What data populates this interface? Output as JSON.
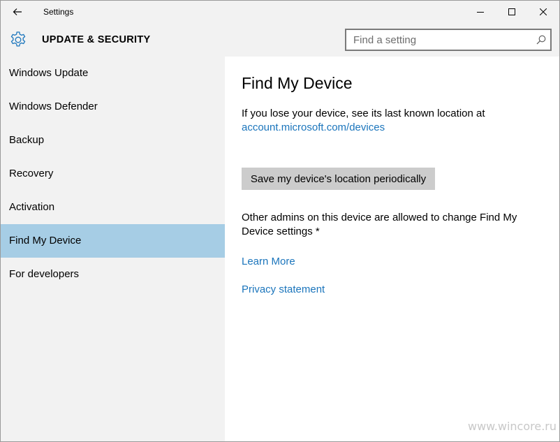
{
  "titlebar": {
    "title": "Settings"
  },
  "header": {
    "section_title": "UPDATE & SECURITY",
    "search_placeholder": "Find a setting"
  },
  "sidebar": {
    "items": [
      {
        "label": "Windows Update"
      },
      {
        "label": "Windows Defender"
      },
      {
        "label": "Backup"
      },
      {
        "label": "Recovery"
      },
      {
        "label": "Activation"
      },
      {
        "label": "Find My Device",
        "selected": true
      },
      {
        "label": "For developers"
      }
    ]
  },
  "content": {
    "title": "Find My Device",
    "description": "If you lose your device, see its last known location at",
    "account_link": "account.microsoft.com/devices",
    "save_button": "Save my device's location periodically",
    "admins_text": "Other admins on this device are allowed to change Find My Device settings *",
    "learn_more": "Learn More",
    "privacy": "Privacy statement"
  },
  "watermark": "www.wincore.ru",
  "colors": {
    "selected_nav": "#a6cde5",
    "link": "#1b75bc",
    "chrome_bg": "#f2f2f2",
    "button_bg": "#cccccc"
  },
  "icons": {
    "back": "back-arrow-icon",
    "section": "gear-icon",
    "search": "search-icon",
    "minimize": "minimize-icon",
    "maximize": "maximize-icon",
    "close": "close-icon"
  }
}
